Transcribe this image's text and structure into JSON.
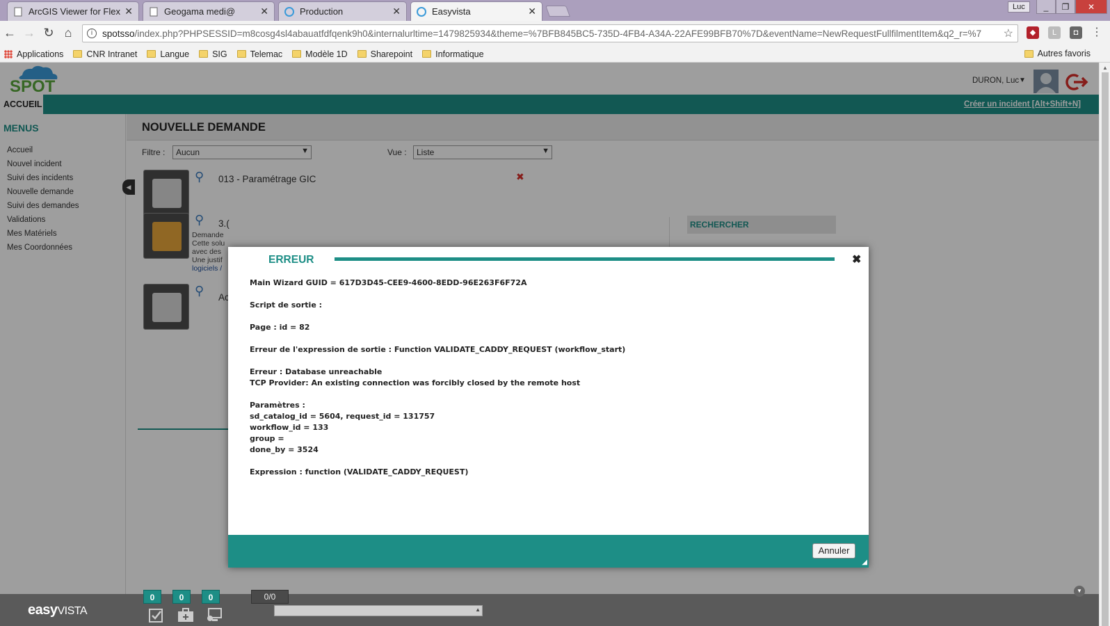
{
  "browser": {
    "tabs": [
      {
        "title": "ArcGIS Viewer for Flex",
        "icon": "page-icon"
      },
      {
        "title": "Geogama medi@",
        "icon": "page-icon"
      },
      {
        "title": "Production",
        "icon": "easyvista-icon"
      },
      {
        "title": "Easyvista",
        "icon": "easyvista-icon"
      }
    ],
    "profile_label": "Luc",
    "url_host": "spotsso",
    "url_rest": "/index.php?PHPSESSID=m8cosg4sl4abauatfdfqenk9h0&internalurltime=1479825934&theme=%7BFB845BC5-735D-4FB4-A34A-22AFE99BFB70%7D&eventName=NewRequestFullfilmentItem&q2_r=%7",
    "bookmarks": [
      "Applications",
      "CNR Intranet",
      "Langue",
      "SIG",
      "Telemac",
      "Modèle 1D",
      "Sharepoint",
      "Informatique"
    ],
    "other_bookmarks": "Autres favoris"
  },
  "app": {
    "logo_text": "SPOT",
    "user_name": "DURON, Luc",
    "nav": {
      "home": "ACCUEIL",
      "quick_incident": "Créer un incident [Alt+Shift+N]"
    },
    "sidebar": {
      "title": "MENUS",
      "items": [
        "Accueil",
        "Nouvel incident",
        "Suivi des incidents",
        "Nouvelle demande",
        "Suivi des demandes",
        "Validations",
        "Mes Matériels",
        "Mes Coordonnées"
      ]
    },
    "page_title": "NOUVELLE DEMANDE",
    "filter": {
      "label": "Filtre :",
      "value": "Aucun"
    },
    "view": {
      "label": "Vue :",
      "value": "Liste"
    },
    "catalog": [
      {
        "title": "013 - Paramétrage GIC"
      },
      {
        "title": "3.(",
        "desc": [
          "Demande",
          "Cette solu",
          "avec des",
          "Une justif"
        ],
        "link": "logiciels / "
      },
      {
        "title": "Ac"
      }
    ],
    "search_title": "RECHERCHER"
  },
  "modal": {
    "title": "ERREUR",
    "lines": [
      "Main Wizard GUID = 617D3D45-CEE9-4600-8EDD-96E263F6F72A",
      "",
      "Script de sortie :",
      "",
      "Page : id = 82",
      "",
      "Erreur de l'expression de sortie : Function VALIDATE_CADDY_REQUEST (workflow_start)",
      "",
      "Erreur : Database unreachable",
      "TCP Provider: An existing connection was forcibly closed by the remote host",
      "",
      "Paramètres :",
      "sd_catalog_id = 5604, request_id = 131757",
      "workflow_id = 133",
      "group =",
      "done_by = 3524",
      "",
      "Expression : function (VALIDATE_CADDY_REQUEST)"
    ],
    "cancel_label": "Annuler"
  },
  "bottombar": {
    "brand_bold": "easy",
    "brand_rest": "VISTA",
    "counters": [
      "0",
      "0",
      "0"
    ],
    "pager": "0/0"
  },
  "colors": {
    "accent": "#1d8e86",
    "title_red": "#c8413d"
  }
}
